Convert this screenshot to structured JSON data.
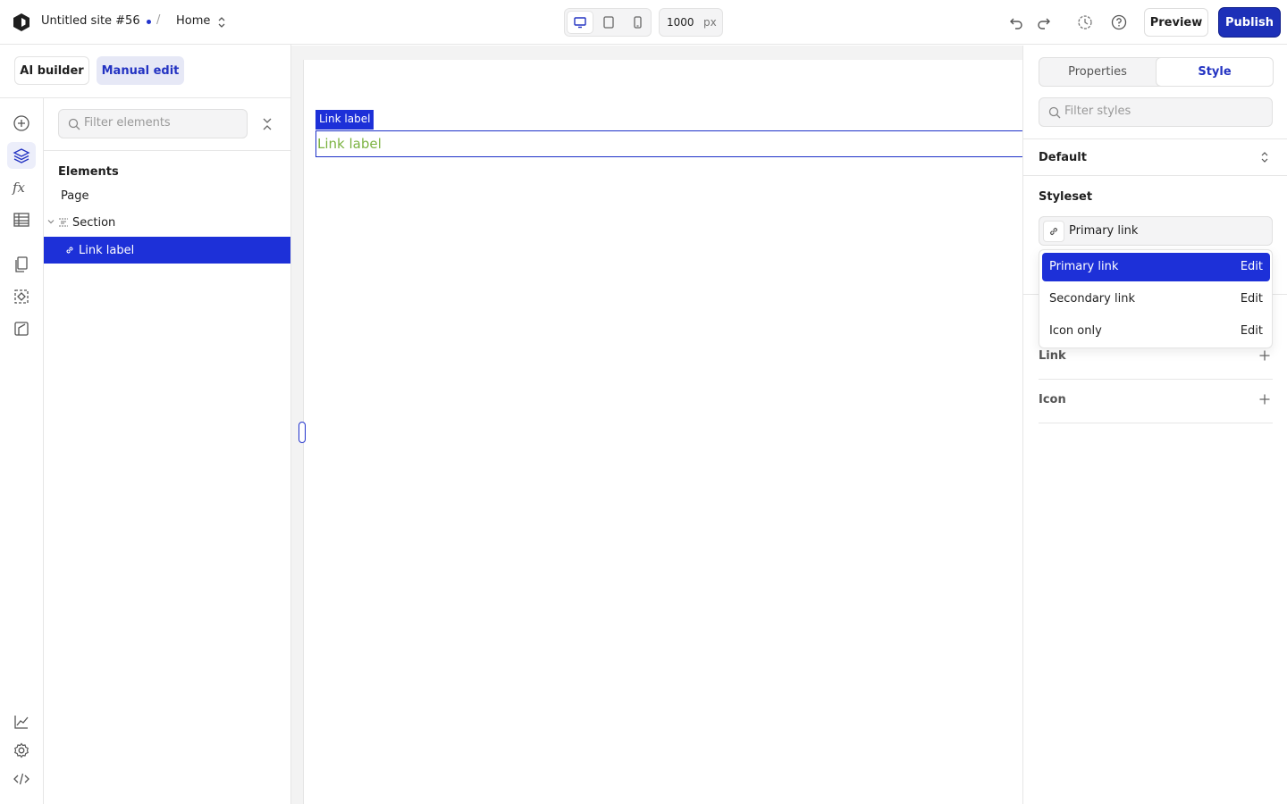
{
  "topbar": {
    "site_name": "Untitled site #56",
    "separator": "/",
    "page": "Home",
    "width_value": "1000",
    "width_unit": "px",
    "preview_label": "Preview",
    "publish_label": "Publish"
  },
  "mode": {
    "ai_label": "AI builder",
    "manual_label": "Manual edit",
    "active": "Manual edit"
  },
  "elements_panel": {
    "search_placeholder": "Filter elements",
    "heading": "Elements",
    "tree": [
      {
        "label": "Page",
        "icon": "none",
        "level": 0
      },
      {
        "label": "Section",
        "icon": "section-icon",
        "level": 0,
        "expanded": true
      },
      {
        "label": "Link label",
        "icon": "link-icon",
        "level": 1,
        "selected": true
      }
    ]
  },
  "canvas": {
    "selection_tag": "Link label",
    "link_text": "Link label"
  },
  "style_panel": {
    "tabs": [
      "Properties",
      "Style"
    ],
    "active_tab": "Style",
    "search_placeholder": "Filter styles",
    "state": "Default",
    "styleset_label": "Styleset",
    "styleset_value": "Primary link",
    "options": [
      {
        "label": "Primary link",
        "action": "Edit",
        "selected": true
      },
      {
        "label": "Secondary link",
        "action": "Edit"
      },
      {
        "label": "Icon only",
        "action": "Edit"
      }
    ],
    "sections": [
      {
        "label": "Link"
      },
      {
        "label": "Icon"
      }
    ]
  },
  "colors": {
    "accent": "#1d30d8",
    "publish": "#1d30b8",
    "link_text": "#7cb342"
  }
}
